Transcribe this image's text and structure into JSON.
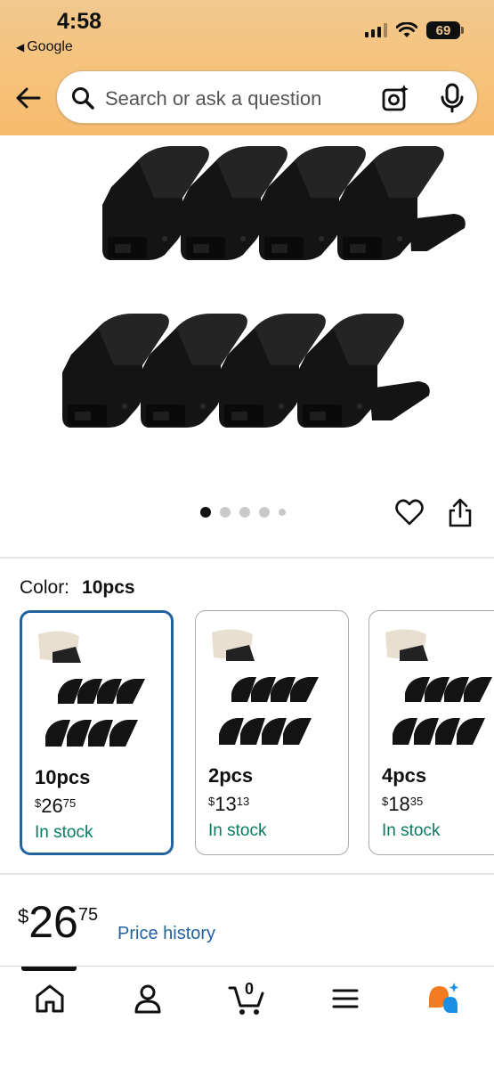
{
  "status_bar": {
    "time": "4:58",
    "back_app": "Google",
    "battery": "69"
  },
  "header": {
    "search_placeholder": "Search or ask a question",
    "icons": [
      "back-arrow-icon",
      "search-icon",
      "camera-lens-icon",
      "microphone-icon"
    ]
  },
  "gallery": {
    "total_images": 5,
    "active_index": 0,
    "actions": [
      "heart-icon",
      "share-icon"
    ]
  },
  "color": {
    "label": "Color:",
    "selected": "10pcs"
  },
  "variants": [
    {
      "name": "10pcs",
      "price_currency": "$",
      "price_whole": "26",
      "price_fraction": "75",
      "stock": "In stock",
      "selected": true
    },
    {
      "name": "2pcs",
      "price_currency": "$",
      "price_whole": "13",
      "price_fraction": "13",
      "stock": "In stock",
      "selected": false
    },
    {
      "name": "4pcs",
      "price_currency": "$",
      "price_whole": "18",
      "price_fraction": "35",
      "stock": "In stock",
      "selected": false
    }
  ],
  "price": {
    "currency": "$",
    "whole": "26",
    "fraction": "75",
    "history_link": "Price history"
  },
  "bottom_nav": {
    "items": [
      "home-icon",
      "account-icon",
      "cart-icon",
      "menu-icon",
      "rufus-ai-icon"
    ],
    "cart_count": "0",
    "active": "home-icon"
  },
  "colors": {
    "header_orange": "#f5c37d",
    "link_blue": "#2162a1",
    "stock_green": "#067d62",
    "selected_border": "#2162a1"
  }
}
